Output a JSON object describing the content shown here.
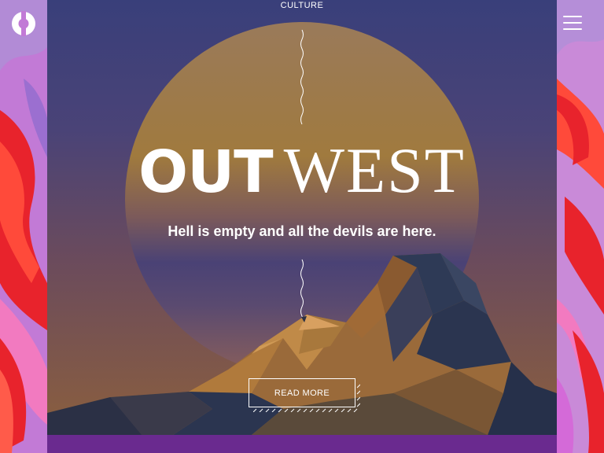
{
  "header": {
    "category": "CULTURE",
    "logo_icon": "brand-logo-icon",
    "menu_icon": "hamburger-menu-icon"
  },
  "hero": {
    "headline_word1": "OUT",
    "headline_word2": "WEST",
    "subtitle": "Hell is empty and all the devils are here.",
    "cta_label": "READ MORE"
  },
  "colors": {
    "panel_top": "#393f7a",
    "sun": "#a07a4a",
    "mountain_dark": "#2b3550",
    "mountain_light": "#a66a3a",
    "footer_strip": "#6a2a8f",
    "side_red": "#e8232c",
    "side_purple": "#b97ad8"
  }
}
